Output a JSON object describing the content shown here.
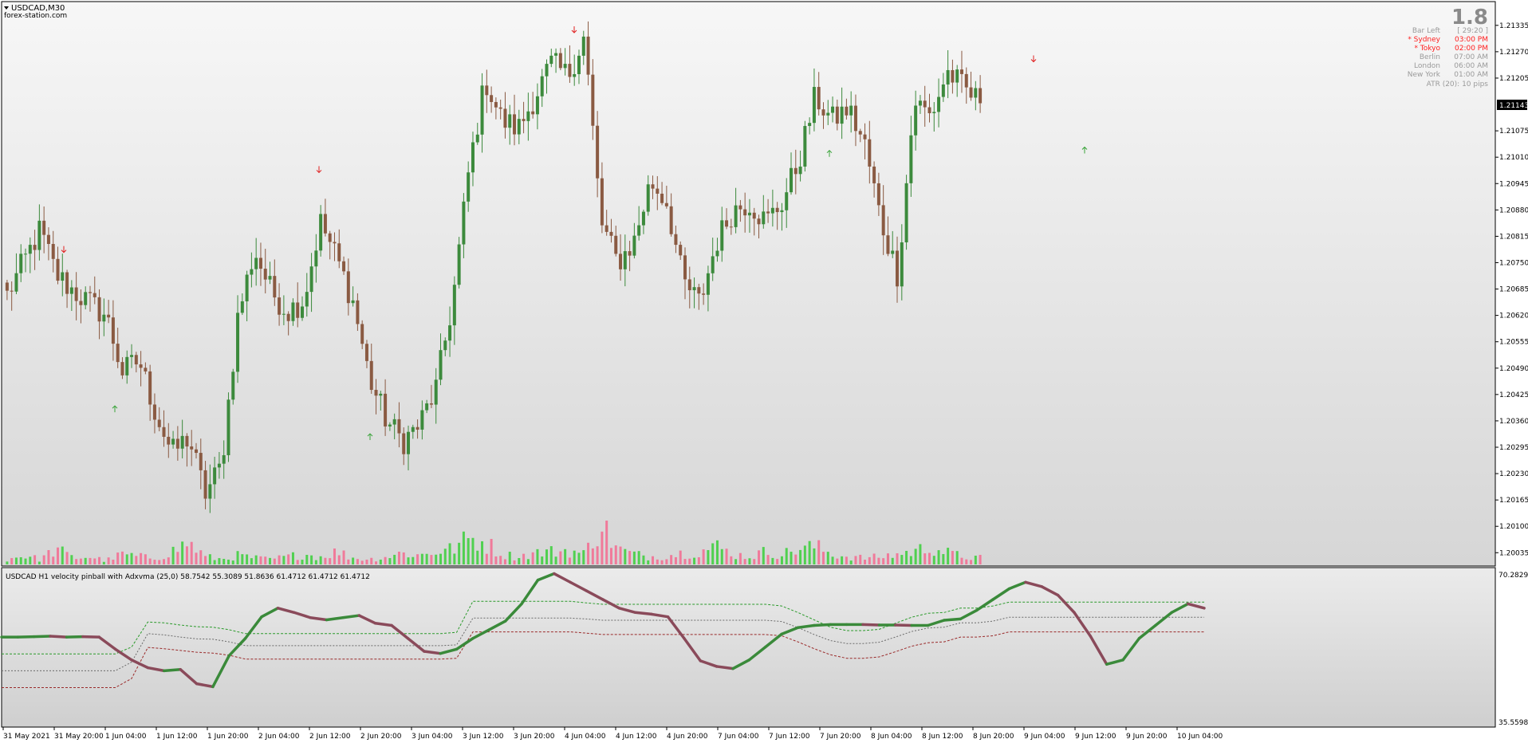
{
  "header": {
    "symbol_label": "USDCAD,M30",
    "watermark": "forex-station.com"
  },
  "info_panel": {
    "big_number": "1.8",
    "rows": [
      {
        "label": "Bar Left",
        "value": "[ 29:20 ]",
        "color": "#9a9a9a"
      },
      {
        "label": "* Sydney",
        "value": "03:00 PM",
        "color": "#ff2020"
      },
      {
        "label": "* Tokyo",
        "value": "02:00 PM",
        "color": "#ff2020"
      },
      {
        "label": "Berlin",
        "value": "07:00 AM",
        "color": "#9a9a9a"
      },
      {
        "label": "London",
        "value": "06:00 AM",
        "color": "#9a9a9a"
      },
      {
        "label": "New York",
        "value": "01:00 AM",
        "color": "#9a9a9a"
      }
    ],
    "atr_text": "ATR (20): 10 pips"
  },
  "price_axis": {
    "ticks": [
      "1.21335",
      "1.21270",
      "1.21205",
      "1.21143",
      "1.21075",
      "1.21010",
      "1.20945",
      "1.20880",
      "1.20815",
      "1.20750",
      "1.20685",
      "1.20620",
      "1.20555",
      "1.20490",
      "1.20425",
      "1.20360",
      "1.20295",
      "1.20230",
      "1.20165",
      "1.20100",
      "1.20035"
    ],
    "current_price": "1.21143"
  },
  "indicator": {
    "title": "USDCAD H1 velocity pinball with Adxvma (25,0) 58.7542 55.3089 51.8636 61.4712 61.4712 61.4712",
    "ymax_label": "70.2829",
    "ymin_label": "35.5598"
  },
  "time_axis": {
    "labels": [
      "31 May 2021",
      "31 May 20:00",
      "1 Jun 04:00",
      "1 Jun 12:00",
      "1 Jun 20:00",
      "2 Jun 04:00",
      "2 Jun 12:00",
      "2 Jun 20:00",
      "3 Jun 04:00",
      "3 Jun 12:00",
      "3 Jun 20:00",
      "4 Jun 04:00",
      "4 Jun 12:00",
      "4 Jun 20:00",
      "7 Jun 04:00",
      "7 Jun 12:00",
      "7 Jun 20:00",
      "8 Jun 04:00",
      "8 Jun 12:00",
      "8 Jun 20:00",
      "9 Jun 04:00",
      "9 Jun 12:00",
      "9 Jun 20:00",
      "10 Jun 04:00"
    ]
  },
  "colors": {
    "bull_candle": "#3c8a3c",
    "bear_candle": "#8a5a42",
    "up_arrow": "#3aa43a",
    "down_arrow": "#e02020",
    "volume_up": "#50d050",
    "volume_down": "#f07a9a",
    "osc_up": "#3a8a3a",
    "osc_down": "#8a4a5a",
    "band_green": "#2a9a2a",
    "band_red": "#9a2a2a"
  },
  "chart_data": [
    {
      "type": "candlestick",
      "title": "USDCAD,M30",
      "ylim": [
        1.2001,
        1.2137
      ],
      "x_labels": [
        "31 May 2021",
        "31 May 20:00",
        "1 Jun 04:00",
        "1 Jun 12:00",
        "1 Jun 20:00",
        "2 Jun 04:00",
        "2 Jun 12:00",
        "2 Jun 20:00",
        "3 Jun 04:00",
        "3 Jun 12:00",
        "3 Jun 20:00",
        "4 Jun 04:00",
        "4 Jun 12:00",
        "4 Jun 20:00",
        "7 Jun 04:00",
        "7 Jun 12:00",
        "7 Jun 20:00",
        "8 Jun 04:00",
        "8 Jun 12:00",
        "8 Jun 20:00",
        "9 Jun 04:00",
        "9 Jun 12:00",
        "9 Jun 20:00",
        "10 Jun 04:00"
      ],
      "close_path": [
        1.2067,
        1.2075,
        1.2083,
        1.2072,
        1.2068,
        1.2065,
        1.2062,
        1.2048,
        1.2051,
        1.2038,
        1.2028,
        1.2032,
        1.2018,
        1.2025,
        1.2062,
        1.2078,
        1.2068,
        1.2063,
        1.2066,
        1.2085,
        1.2076,
        1.2065,
        1.2046,
        1.2036,
        1.2031,
        1.2035,
        1.2044,
        1.2065,
        1.2098,
        1.212,
        1.211,
        1.2108,
        1.2116,
        1.2124,
        1.2121,
        1.2131,
        1.2085,
        1.2075,
        1.208,
        1.2095,
        1.209,
        1.207,
        1.2065,
        1.208,
        1.2088,
        1.209,
        1.2085,
        1.209,
        1.21,
        1.2116,
        1.211,
        1.2113,
        1.2104,
        1.2085,
        1.2072,
        1.2115,
        1.2111,
        1.2122,
        1.2118,
        1.21143
      ],
      "volume_pattern": [
        0.2,
        0.35,
        0.2,
        0.6,
        0.25,
        0.3,
        0.15,
        0.4,
        0.3,
        0.25,
        0.5,
        0.85,
        0.3,
        0.2,
        0.35,
        0.25,
        0.2,
        0.3,
        0.4,
        0.3,
        0.5,
        0.25,
        0.2,
        0.3,
        0.45,
        0.35,
        0.5,
        0.6,
        1.0,
        0.85,
        0.4,
        0.3,
        0.45,
        0.5,
        0.55,
        0.4,
        1.6,
        0.6,
        0.4,
        0.3,
        0.35,
        0.45,
        0.5,
        0.7,
        0.4,
        0.3,
        0.5,
        0.4,
        0.6,
        0.7,
        0.4,
        0.3,
        0.25,
        0.3,
        0.4,
        0.5,
        0.7,
        0.45,
        0.3,
        0.25
      ],
      "up_arrow_times": [
        "1 Jun 04:00",
        "2 Jun 20:00",
        "7 Jun 20:00",
        "9 Jun 12:00"
      ],
      "down_arrow_times": [
        "31 May 20:00",
        "2 Jun 12:00",
        "4 Jun 04:00",
        "9 Jun 04:00"
      ]
    },
    {
      "type": "line",
      "title": "USDCAD H1 velocity pinball with Adxvma (25,0)",
      "ylim": [
        35.5598,
        70.2829
      ],
      "series": [
        {
          "name": "",
          "values": [
            55.3,
            55.3,
            55.4,
            55.5,
            55.3,
            55.4,
            55.3,
            52.5,
            50.0,
            48.2,
            47.5,
            47.8,
            44.5,
            43.8,
            51.0,
            55.0,
            60.0,
            62.0,
            61.0,
            59.8,
            59.3,
            59.8,
            60.3,
            58.5,
            58.0,
            55.0,
            52.0,
            51.5,
            52.5,
            55.0,
            57.0,
            59.0,
            63.0,
            68.5,
            70.0,
            68.0,
            66.0,
            64.0,
            62.0,
            61.0,
            60.6,
            60.0,
            55.0,
            49.8,
            48.5,
            48.0,
            50.0,
            53.0,
            56.0,
            57.5,
            58.0,
            58.2,
            58.2,
            58.2,
            58.1,
            58.1,
            58.0,
            58.0,
            59.2,
            59.5,
            61.5,
            64.0,
            66.5,
            68.0,
            67.0,
            65.0,
            61.0,
            55.5,
            49.0,
            50.0,
            55.0,
            58.0,
            61.0,
            63.0,
            62.0
          ]
        },
        {
          "name": "",
          "values": [
            51.4,
            51.4,
            51.4,
            51.4,
            51.4,
            51.4,
            51.4,
            51.4,
            53.0,
            58.8,
            58.6,
            58.1,
            57.7,
            57.6,
            57.0,
            56.1,
            56.1,
            56.1,
            56.1,
            56.1,
            56.1,
            56.1,
            56.1,
            56.1,
            56.1,
            56.1,
            56.1,
            56.1,
            56.4,
            63.6,
            63.6,
            63.6,
            63.6,
            63.6,
            63.6,
            63.6,
            63.2,
            62.9,
            62.9,
            62.9,
            62.9,
            62.9,
            62.9,
            62.9,
            62.9,
            62.9,
            62.9,
            62.9,
            62.5,
            61.0,
            59.3,
            57.6,
            56.8,
            56.8,
            57.1,
            58.5,
            59.9,
            60.8,
            61.0,
            62.0,
            62.0,
            62.5,
            63.4,
            63.4,
            63.4,
            63.4,
            63.4,
            63.4,
            63.4,
            63.4,
            63.4,
            63.4,
            63.4,
            63.4,
            63.4
          ]
        },
        {
          "name": "",
          "values": [
            47.5,
            47.5,
            47.5,
            47.5,
            47.5,
            47.5,
            47.5,
            47.5,
            49.5,
            56.1,
            55.8,
            55.3,
            54.9,
            54.8,
            54.2,
            53.3,
            53.3,
            53.3,
            53.3,
            53.3,
            53.3,
            53.3,
            53.3,
            53.3,
            53.3,
            53.3,
            53.3,
            53.3,
            53.5,
            59.7,
            59.7,
            59.7,
            59.7,
            59.7,
            59.7,
            59.7,
            59.5,
            59.2,
            59.2,
            59.2,
            59.2,
            59.2,
            59.2,
            59.2,
            59.2,
            59.2,
            59.2,
            59.2,
            58.9,
            57.5,
            55.9,
            54.5,
            53.8,
            53.8,
            54.1,
            55.3,
            56.6,
            57.4,
            57.6,
            58.6,
            58.6,
            59.0,
            59.9,
            59.9,
            59.9,
            59.9,
            59.9,
            59.9,
            59.9,
            59.9,
            59.9,
            59.9,
            59.9,
            59.9,
            59.9
          ]
        },
        {
          "name": "",
          "values": [
            43.6,
            43.6,
            43.6,
            43.6,
            43.6,
            43.6,
            43.6,
            43.6,
            45.7,
            52.9,
            52.6,
            52.2,
            51.8,
            51.6,
            51.1,
            50.2,
            50.2,
            50.2,
            50.2,
            50.2,
            50.2,
            50.2,
            50.2,
            50.2,
            50.2,
            50.2,
            50.2,
            50.2,
            50.4,
            56.5,
            56.5,
            56.5,
            56.5,
            56.5,
            56.5,
            56.5,
            56.2,
            55.9,
            55.9,
            55.9,
            55.9,
            55.9,
            55.9,
            55.9,
            55.9,
            55.9,
            55.9,
            55.9,
            55.6,
            54.2,
            52.6,
            51.2,
            50.4,
            50.4,
            50.7,
            51.9,
            53.2,
            54.0,
            54.2,
            55.3,
            55.3,
            55.6,
            56.5,
            56.5,
            56.5,
            56.5,
            56.5,
            56.5,
            56.5,
            56.5,
            56.5,
            56.5,
            56.5,
            56.5,
            56.5
          ]
        }
      ]
    }
  ]
}
